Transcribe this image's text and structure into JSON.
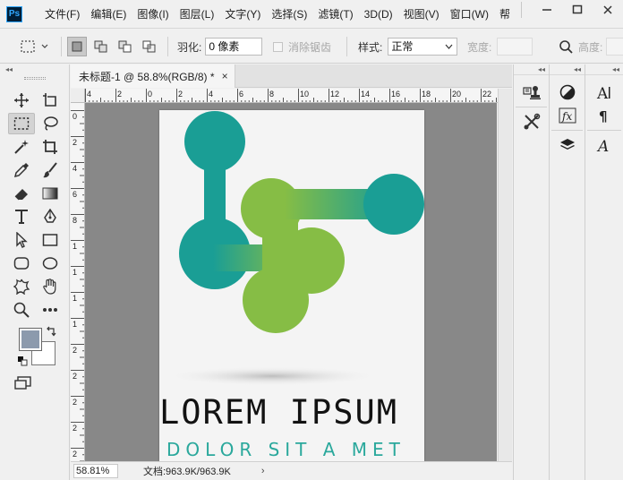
{
  "app": {
    "logo": "Ps",
    "menu": [
      "文件(F)",
      "编辑(E)",
      "图像(I)",
      "图层(L)",
      "文字(Y)",
      "选择(S)",
      "滤镜(T)",
      "3D(D)",
      "视图(V)",
      "窗口(W)",
      "帮"
    ]
  },
  "options": {
    "feather_label": "羽化:",
    "feather_value": "0 像素",
    "antialias_label": "消除锯齿",
    "style_label": "样式:",
    "style_value": "正常",
    "width_label": "宽度:",
    "height_label": "高度:"
  },
  "document": {
    "tab_title": "未标题-1 @ 58.8%(RGB/8) *",
    "close_glyph": "×",
    "hruler_labels": [
      "4",
      "2",
      "0",
      "2",
      "4",
      "6",
      "8",
      "10",
      "12",
      "14",
      "16",
      "18",
      "20",
      "22"
    ],
    "vruler_labels": [
      "0",
      "2",
      "4",
      "6",
      "8",
      "1",
      "1",
      "1",
      "1",
      "2",
      "2",
      "2",
      "2",
      "2"
    ],
    "status_zoom": "58.81%",
    "status_doc": "文档:963.9K/963.9K",
    "status_arrow": "›"
  },
  "artwork": {
    "headline": "LOREM IPSUM",
    "tagline": "DOLOR SIT A MET",
    "teal": "#1a9e95",
    "green": "#86bd45",
    "headline_color": "#121212",
    "tagline_color": "#2aa89c"
  },
  "icons": {
    "tools": [
      "move-icon",
      "artboard-icon",
      "marquee-icon",
      "lasso-icon",
      "magic-wand-icon",
      "crop-icon",
      "eyedropper-icon",
      "brush-icon",
      "eraser-icon",
      "gradient-icon",
      "type-icon",
      "pen-icon",
      "path-select-icon",
      "rectangle-icon",
      "rounded-rect-icon",
      "ellipse-icon",
      "custom-shape-icon",
      "hand-icon",
      "zoom-icon",
      "more-icon"
    ]
  },
  "colors": {
    "foreground": "#8c9aad",
    "background": "#ffffff"
  }
}
